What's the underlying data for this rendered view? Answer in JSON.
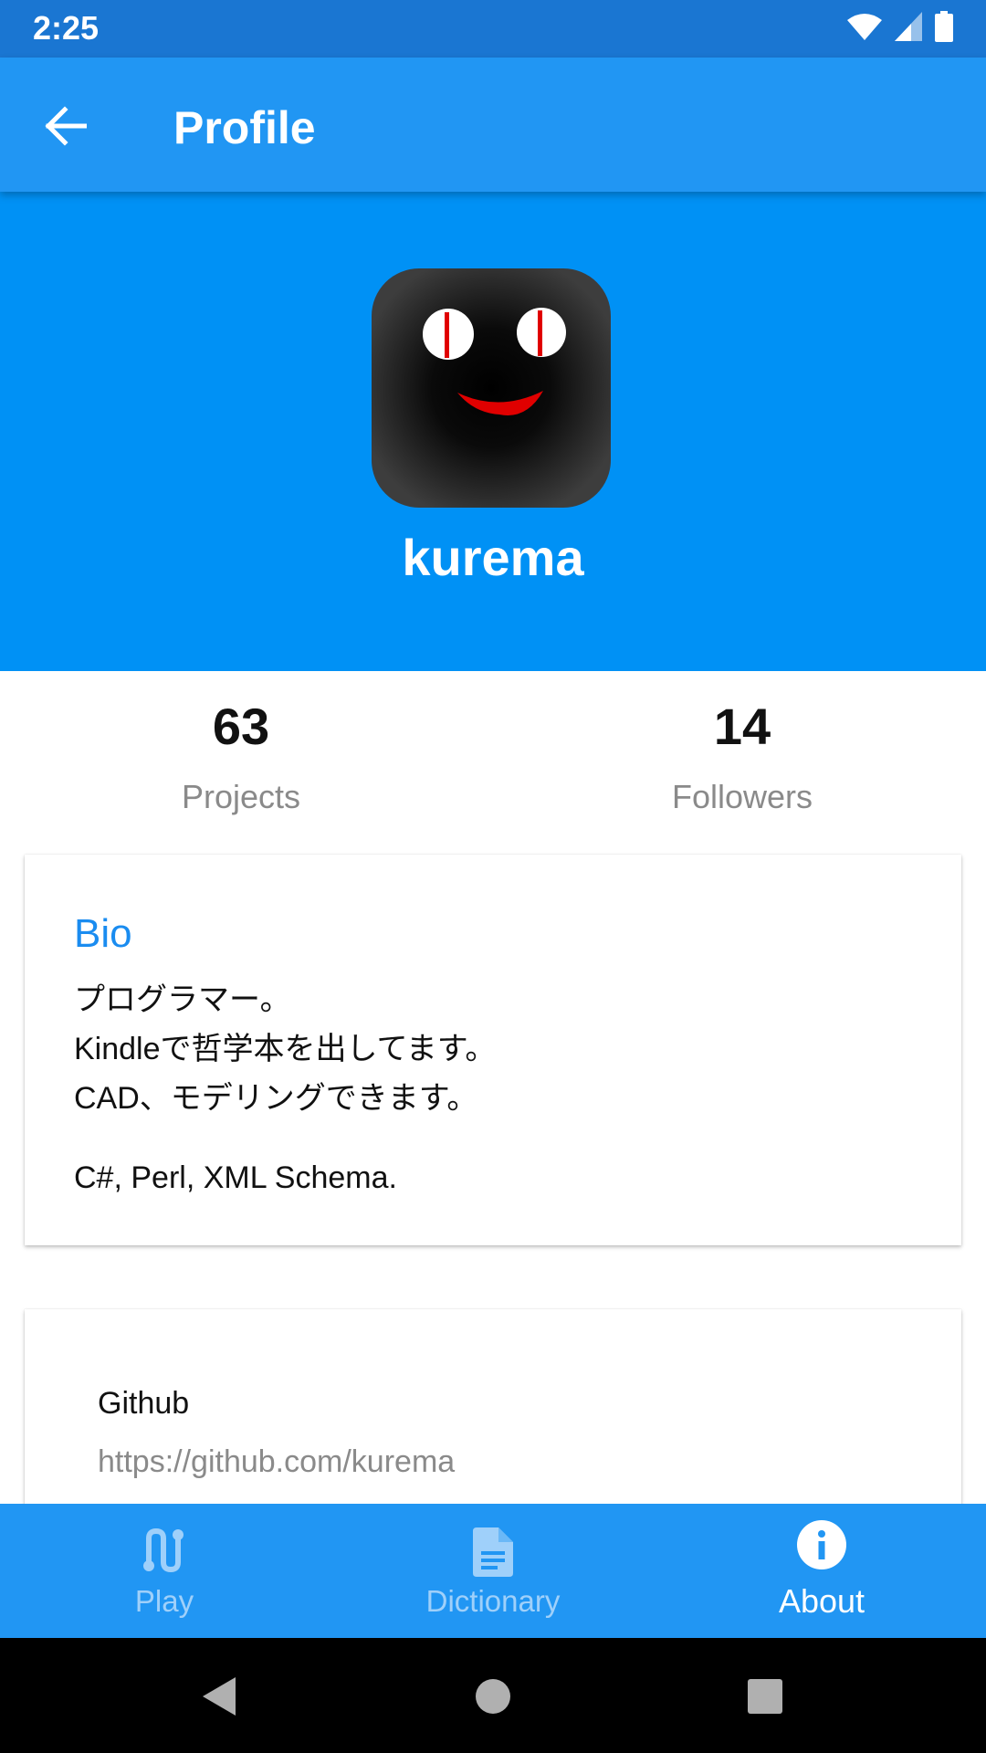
{
  "status_bar": {
    "time": "2:25"
  },
  "app_bar": {
    "title": "Profile"
  },
  "profile": {
    "username": "kurema"
  },
  "stats": {
    "projects": {
      "value": "63",
      "label": "Projects"
    },
    "followers": {
      "value": "14",
      "label": "Followers"
    }
  },
  "bio": {
    "title": "Bio",
    "lines": [
      "プログラマー。",
      "Kindleで哲学本を出してます。",
      "CAD、モデリングできます。"
    ],
    "languages": "C#, Perl, XML Schema."
  },
  "links": [
    {
      "label": "Github",
      "url": "https://github.com/kurema"
    }
  ],
  "bottom_nav": {
    "items": [
      {
        "label": "Play",
        "icon": "play-icon",
        "active": false
      },
      {
        "label": "Dictionary",
        "icon": "document-icon",
        "active": false
      },
      {
        "label": "About",
        "icon": "info-icon",
        "active": true
      }
    ]
  },
  "colors": {
    "status_bar": "#1a76d2",
    "app_bar": "#2196f3",
    "hero": "#0091f5",
    "accent": "#1a8cf0"
  }
}
